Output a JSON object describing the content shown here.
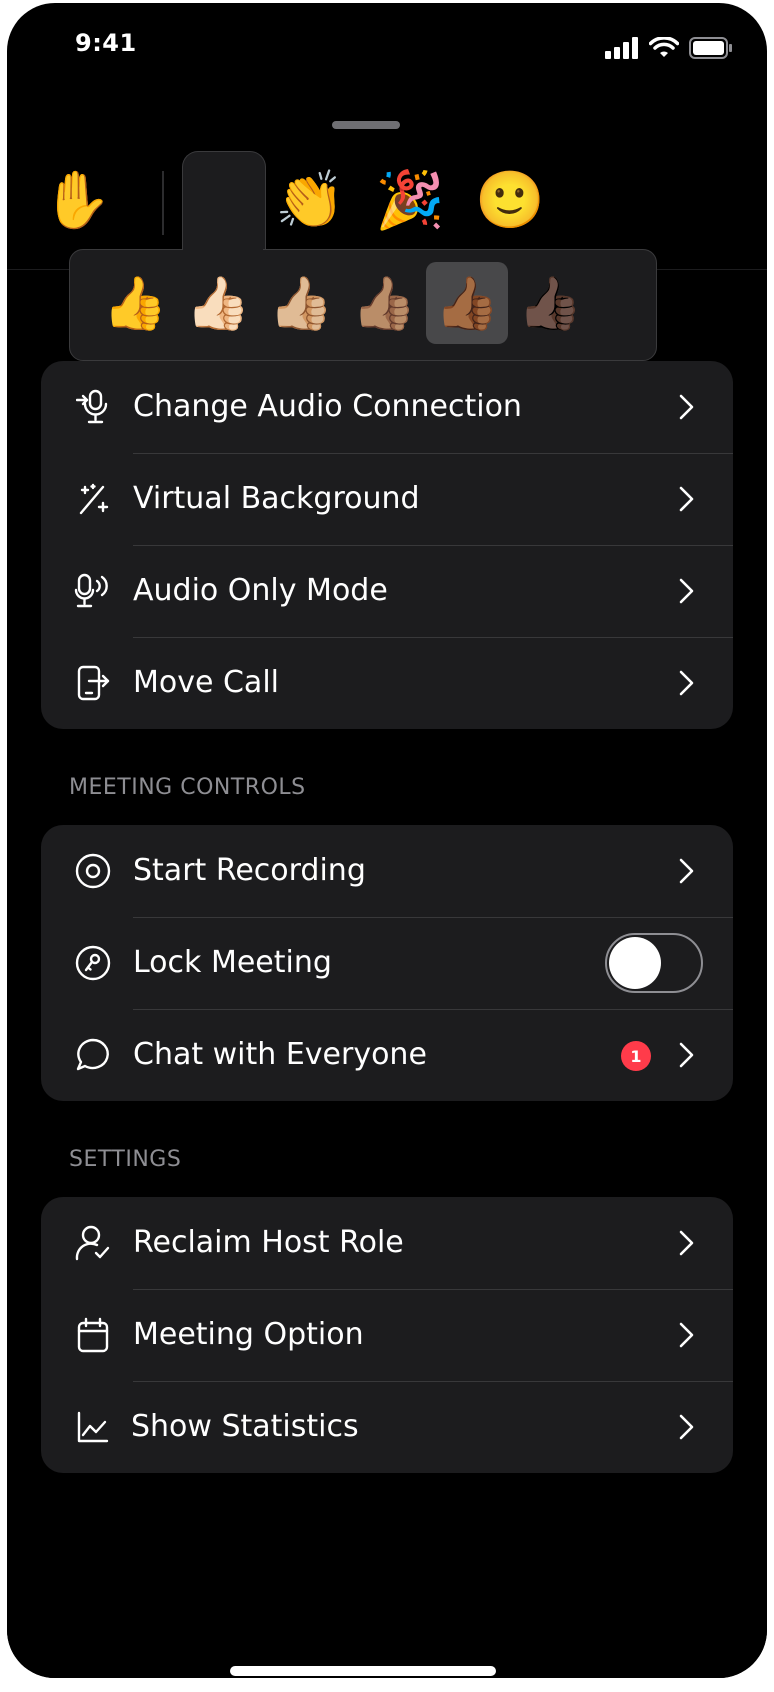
{
  "status_bar": {
    "time": "9:41"
  },
  "reactions": [
    {
      "emoji": "✋",
      "name": "raised-hand"
    },
    {
      "emoji": "👍",
      "name": "thumbs-up"
    },
    {
      "emoji": "👏",
      "name": "clapping-hands"
    },
    {
      "emoji": "🎉",
      "name": "party-popper"
    },
    {
      "emoji": "🙂",
      "name": "smiling-face"
    },
    {
      "emoji": "😆",
      "name": "laughing-face"
    },
    {
      "emoji": "😮",
      "name": "surprised-face"
    }
  ],
  "skin_tones": [
    "👍",
    "👍🏻",
    "👍🏼",
    "👍🏽",
    "👍🏾",
    "👍🏿"
  ],
  "skin_tone_selected_index": 4,
  "audio_card": {
    "items": [
      {
        "label": "Change Audio Connection",
        "icon": "audio-connection-icon"
      },
      {
        "label": "Virtual Background",
        "icon": "magic-wand-icon"
      },
      {
        "label": "Audio Only Mode",
        "icon": "microphone-waves-icon"
      },
      {
        "label": "Move Call",
        "icon": "move-call-icon"
      }
    ]
  },
  "meeting_controls": {
    "header": "MEETING CONTROLS",
    "items": [
      {
        "label": "Start Recording",
        "icon": "record-icon"
      },
      {
        "label": "Lock Meeting",
        "icon": "lock-icon",
        "toggle_on": false
      },
      {
        "label": "Chat with Everyone",
        "icon": "chat-bubble-icon",
        "badge": "1"
      }
    ]
  },
  "settings": {
    "header": "SETTINGS",
    "items": [
      {
        "label": "Reclaim Host Role",
        "icon": "host-role-icon"
      },
      {
        "label": "Meeting Option",
        "icon": "calendar-icon"
      },
      {
        "label": "Show Statistics",
        "icon": "statistics-chart-icon"
      }
    ]
  },
  "colors": {
    "background": "#000000",
    "card": "#1c1c1e",
    "separator": "#38383a",
    "secondary_text": "#8e8e93",
    "badge": "#ff3b4a"
  }
}
